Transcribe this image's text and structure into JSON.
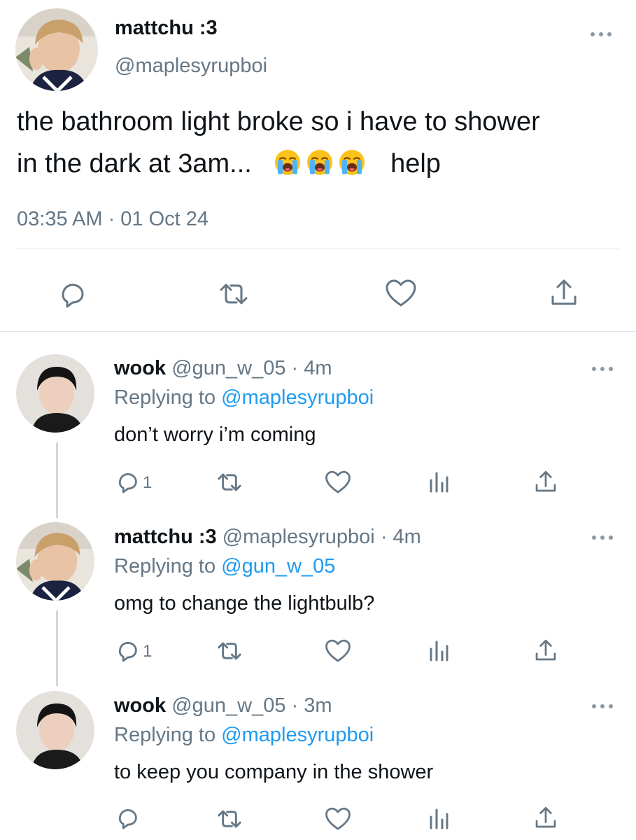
{
  "colors": {
    "link": "#1d9bf0",
    "meta": "#657786",
    "icon": "#657786",
    "divider": "#e1e8ed"
  },
  "main_tweet": {
    "display_name": "mattchu :3",
    "handle": "@maplesyrupboi",
    "text_line1": "the bathroom light broke so i have to shower",
    "text_line2_before": "in the dark at 3am...",
    "emoji": "loudly-crying-face",
    "emoji_count": 3,
    "text_line2_after": "help",
    "timestamp": "03:35 AM · 01 Oct 24",
    "actions": [
      "reply-icon",
      "retweet-icon",
      "like-icon",
      "share-icon"
    ]
  },
  "replies": [
    {
      "display_name": "wook",
      "handle": "@gun_w_05",
      "time": "· 4m",
      "replying_label": "Replying to",
      "replying_to": "@maplesyrupboi",
      "text": "don’t worry i’m coming",
      "reply_count": "1"
    },
    {
      "display_name": "mattchu :3",
      "handle": "@maplesyrupboi",
      "time": "· 4m",
      "replying_label": "Replying to",
      "replying_to": "@gun_w_05",
      "text": "omg to change the lightbulb?",
      "reply_count": "1"
    },
    {
      "display_name": "wook",
      "handle": "@gun_w_05",
      "time": "· 3m",
      "replying_label": "Replying to",
      "replying_to": "@maplesyrupboi",
      "text": "to keep you company in the shower",
      "reply_count": ""
    }
  ]
}
